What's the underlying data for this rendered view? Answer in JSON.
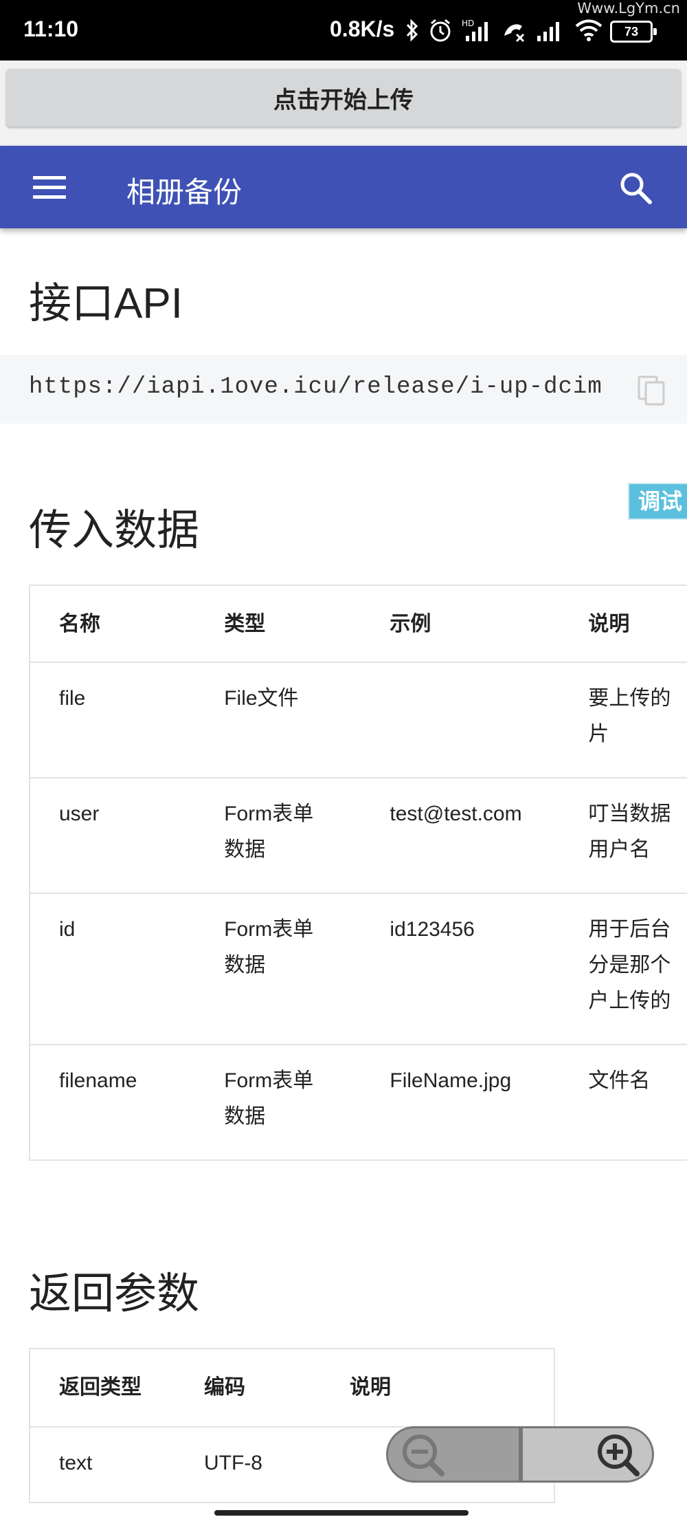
{
  "status_bar": {
    "time": "11:10",
    "net_speed": "0.8K/s",
    "battery": "73",
    "watermark": "Www.LgYm.cn"
  },
  "upload_button": {
    "label": "点击开始上传"
  },
  "app_bar": {
    "title": "相册备份",
    "color": "#3f51b5"
  },
  "api_section": {
    "heading": "接口API",
    "url": "https://iapi.1ove.icu/release/i-up-dcim"
  },
  "debug_badge": {
    "label": "调试",
    "color": "#5bc0de"
  },
  "input_section": {
    "heading": "传入数据",
    "columns": [
      "名称",
      "类型",
      "示例",
      "说明"
    ],
    "rows": [
      {
        "name": "file",
        "type": "File文件",
        "example": "",
        "desc": "要上传的\n片"
      },
      {
        "name": "user",
        "type": "Form表单\n数据",
        "example": "test@test.com",
        "desc": "叮当数据\n用户名"
      },
      {
        "name": "id",
        "type": "Form表单\n数据",
        "example": "id123456",
        "desc": "用于后台\n分是那个\n户上传的"
      },
      {
        "name": "filename",
        "type": "Form表单\n数据",
        "example": "FileName.jpg",
        "desc": "文件名"
      }
    ]
  },
  "return_section": {
    "heading": "返回参数",
    "columns": [
      "返回类型",
      "编码",
      "说明"
    ],
    "rows": [
      {
        "type": "text",
        "encoding": "UTF-8",
        "desc": ""
      }
    ]
  },
  "icons": {
    "menu": "menu-icon",
    "search": "search-icon",
    "copy": "copy-icon",
    "zoom_out": "zoom-out-icon",
    "zoom_in": "zoom-in-icon"
  }
}
